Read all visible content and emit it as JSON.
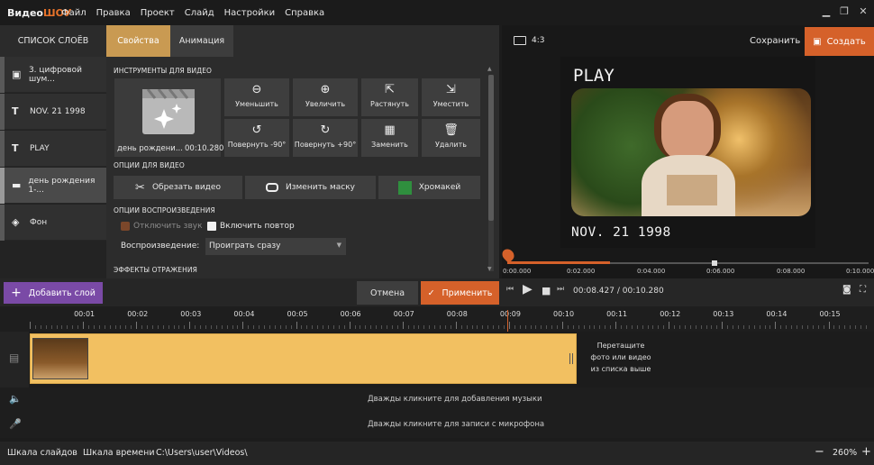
{
  "app": {
    "logo_a": "Видео",
    "logo_b": "ШОУ"
  },
  "menu": [
    "Файл",
    "Правка",
    "Проект",
    "Слайд",
    "Настройки",
    "Справка"
  ],
  "layers": {
    "header": "СПИСОК СЛОЁВ",
    "items": [
      {
        "icon": "image-icon",
        "label": "3. цифровой шум..."
      },
      {
        "icon": "text-icon",
        "label": "NOV. 21 1998"
      },
      {
        "icon": "text-icon",
        "label": "PLAY"
      },
      {
        "icon": "video-icon",
        "label": "день рождения 1-..."
      },
      {
        "icon": "fill-icon",
        "label": "Фон"
      }
    ]
  },
  "tabs": {
    "properties": "Свойства",
    "animation": "Анимация"
  },
  "tools": {
    "section": "ИНСТРУМЕНТЫ ДЛЯ ВИДЕО",
    "thumb_name": "день рождени...",
    "thumb_time": "00:10.280",
    "buttons": [
      {
        "icon": "🔍",
        "label": "Уменьшить"
      },
      {
        "icon": "🔍",
        "label": "Увеличить"
      },
      {
        "icon": "⇱",
        "label": "Растянуть"
      },
      {
        "icon": "⇲",
        "label": "Уместить"
      },
      {
        "icon": "↺",
        "label": "Повернуть -90°"
      },
      {
        "icon": "↻",
        "label": "Повернуть +90°"
      },
      {
        "icon": "▦",
        "label": "Заменить"
      },
      {
        "icon": "🗑",
        "label": "Удалить"
      }
    ]
  },
  "video_options": {
    "section": "ОПЦИИ ДЛЯ ВИДЕО",
    "trim": "Обрезать видео",
    "mask": "Изменить маску",
    "chroma": "Хромакей"
  },
  "playback": {
    "section": "ОПЦИИ ВОСПРОИЗВЕДЕНИЯ",
    "mute": "Отключить звук",
    "loop": "Включить повтор",
    "play_label": "Воспроизведение:",
    "play_value": "Проиграть сразу"
  },
  "reflection": {
    "section": "ЭФФЕКТЫ ОТРАЖЕНИЯ"
  },
  "preview": {
    "ratio": "4:3",
    "save": "Сохранить",
    "create": "Создать",
    "title": "PLAY",
    "date": "NOV. 21 1998",
    "progress": 0.293,
    "ticks": [
      "0:00.000",
      "0:02.000",
      "0:04.000",
      "0:06.000",
      "0:08.000",
      "0:10.000"
    ]
  },
  "actions": {
    "add_layer": "Добавить слой",
    "cancel": "Отмена",
    "apply": "Применить",
    "current": "00:08.427",
    "total": "00:10.280",
    "sep": " / "
  },
  "timeline": {
    "labels": [
      "00:01",
      "00:02",
      "00:03",
      "00:04",
      "00:05",
      "00:06",
      "00:07",
      "00:08",
      "00:09",
      "00:10",
      "00:11",
      "00:12",
      "00:13",
      "00:14",
      "00:15"
    ],
    "drop_hint": "Перетащите фото или видео из списка выше",
    "music_hint": "Дважды кликните для добавления музыки",
    "mic_hint": "Дважды кликните для записи с микрофона"
  },
  "status": {
    "slides": "Шкала слайдов",
    "timeline": "Шкала времени",
    "path": "C:\\Users\\user\\Videos\\",
    "zoom": "260%"
  }
}
